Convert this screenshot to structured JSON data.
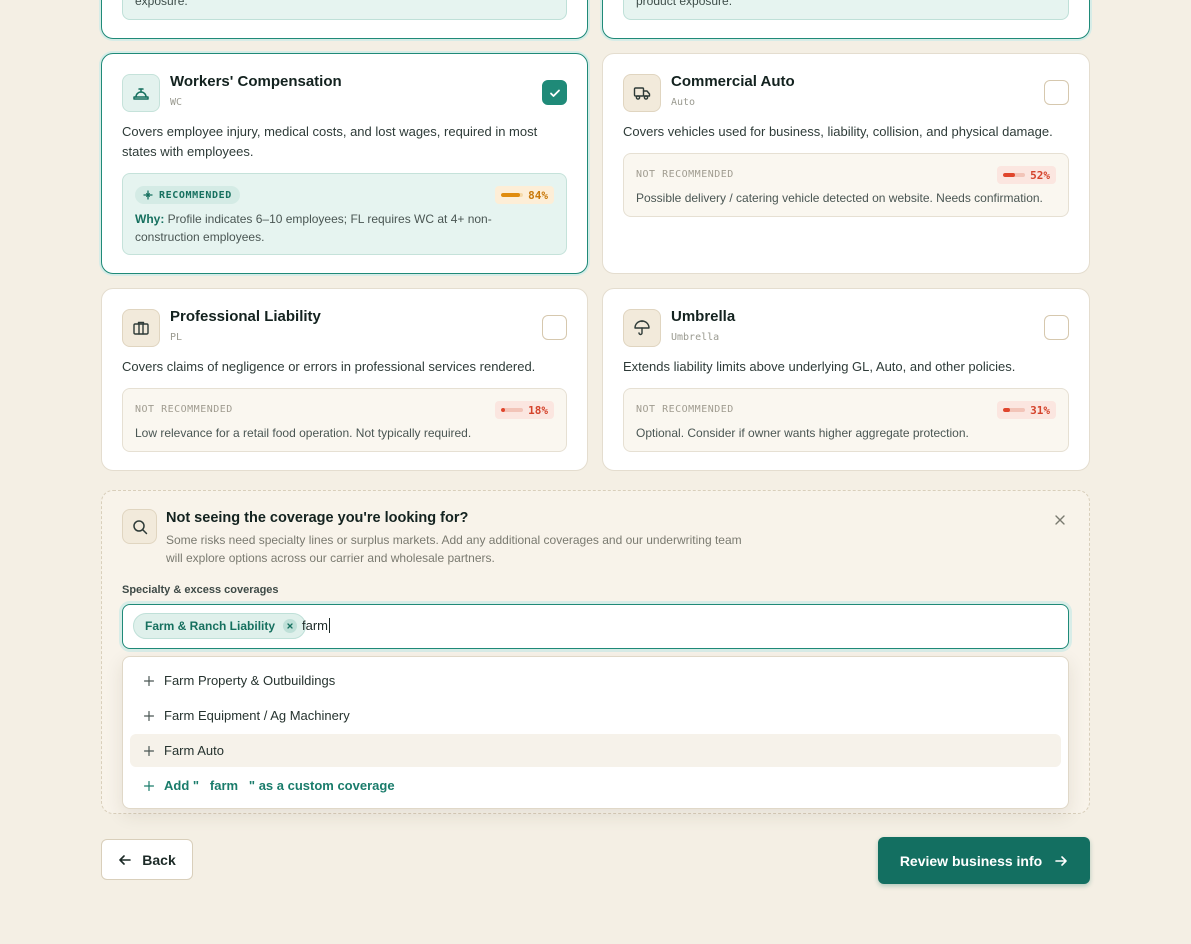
{
  "top_cards": [
    {
      "text_tail": "exposure."
    },
    {
      "text_tail": "product exposure."
    }
  ],
  "coverages": [
    {
      "title": "Workers' Compensation",
      "code": "WC",
      "icon": "hard-hat-icon",
      "selected": true,
      "description": "Covers employee injury, medical costs, and lost wages, required in most states with employees.",
      "recommendation": {
        "label": "RECOMMENDED",
        "score_text": "84%",
        "score": 0.84,
        "why_label": "Why:",
        "text": "Profile indicates 6–10 employees; FL requires WC at 4+ non-construction employees."
      }
    },
    {
      "title": "Commercial Auto",
      "code": "Auto",
      "icon": "truck-icon",
      "selected": false,
      "description": "Covers vehicles used for business, liability, collision, and physical damage.",
      "recommendation": {
        "label": "NOT RECOMMENDED",
        "score_text": "52%",
        "score": 0.52,
        "text": "Possible delivery / catering vehicle detected on website. Needs confirmation."
      }
    },
    {
      "title": "Professional Liability",
      "code": "PL",
      "icon": "briefcase-icon",
      "selected": false,
      "description": "Covers claims of negligence or errors in professional services rendered.",
      "recommendation": {
        "label": "NOT RECOMMENDED",
        "score_text": "18%",
        "score": 0.18,
        "text": "Low relevance for a retail food operation. Not typically required."
      }
    },
    {
      "title": "Umbrella",
      "code": "Umbrella",
      "icon": "umbrella-icon",
      "selected": false,
      "description": "Extends liability limits above underlying GL, Auto, and other policies.",
      "recommendation": {
        "label": "NOT RECOMMENDED",
        "score_text": "31%",
        "score": 0.31,
        "text": "Optional. Consider if owner wants higher aggregate protection."
      }
    }
  ],
  "specialty": {
    "title": "Not seeing the coverage you're looking for?",
    "description": "Some risks need specialty lines or surplus markets. Add any additional coverages and our underwriting team will explore options across our carrier and wholesale partners.",
    "field_label": "Specialty & excess coverages",
    "chips": [
      "Farm & Ranch Liability"
    ],
    "query": "farm",
    "options": [
      "Farm Property & Outbuildings",
      "Farm Equipment / Ag Machinery",
      "Farm Auto"
    ],
    "highlighted_option": "Farm Auto",
    "custom_prefix": "Add \"",
    "custom_query": "farm",
    "custom_suffix": "\" as a custom coverage"
  },
  "footer": {
    "back_label": "Back",
    "next_label": "Review business info"
  },
  "colors": {
    "accent": "#1f8a78",
    "primary_button": "#136f61",
    "background": "#f4efe4",
    "danger": "#e0452c",
    "warning": "#e08c0e"
  }
}
